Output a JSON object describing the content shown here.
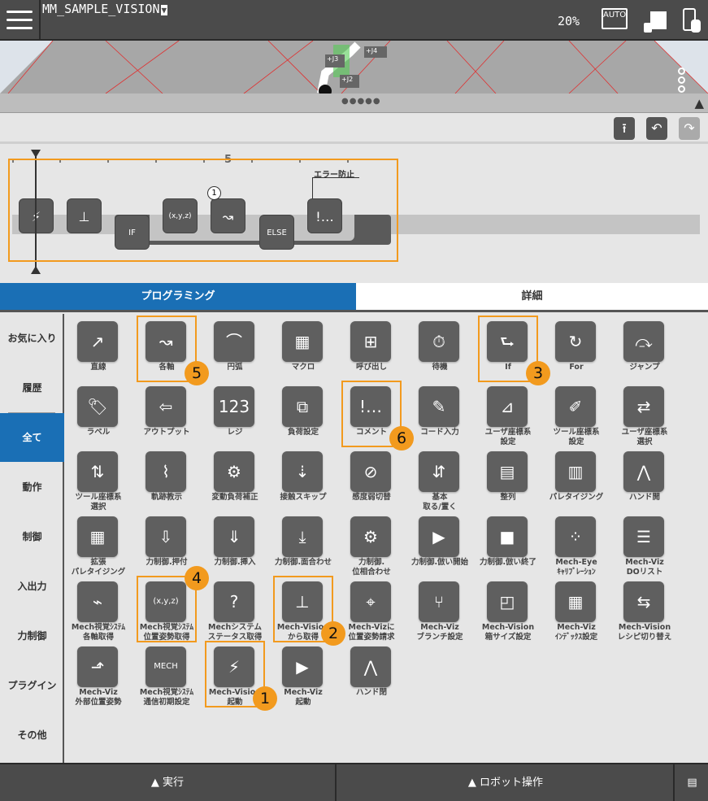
{
  "header": {
    "program_name": "MM_SAMPLE_VISION",
    "dropdown_glyph": "▼",
    "speed": "20%",
    "auto_label": "AUTO",
    "joint_labels": [
      "+J4",
      "+J3",
      "+J2"
    ]
  },
  "toolbar": {
    "upload_glyph": "⭱",
    "undo_glyph": "↶",
    "redo_glyph": "↷"
  },
  "timeline": {
    "ruler_label": "5",
    "comment_label": "エラー防止",
    "marker": "1",
    "blocks": [
      {
        "name": "mech-vision-start-block",
        "glyph": "⚡"
      },
      {
        "name": "mech-vision-get-block",
        "glyph": "⊥"
      },
      {
        "name": "if-block",
        "glyph": "IF"
      },
      {
        "name": "position-get-block",
        "glyph": "(x,y,z)"
      },
      {
        "name": "joint-move-block",
        "glyph": "↝"
      },
      {
        "name": "else-block",
        "glyph": "ELSE"
      },
      {
        "name": "comment-block",
        "glyph": "!…"
      }
    ]
  },
  "tabs": {
    "programming": "プログラミング",
    "details": "詳細"
  },
  "sidebar": {
    "items": [
      "お気に入り",
      "履歴",
      "全て",
      "動作",
      "制御",
      "入出力",
      "力制御",
      "プラグイン",
      "その他"
    ],
    "selected": "全て"
  },
  "palette": [
    {
      "label": "直線",
      "glyph": "↗"
    },
    {
      "label": "各軸",
      "glyph": "↝"
    },
    {
      "label": "円弧",
      "glyph": "⌒"
    },
    {
      "label": "マクロ",
      "glyph": "▦"
    },
    {
      "label": "呼び出し",
      "glyph": "⊞"
    },
    {
      "label": "待機",
      "glyph": "⏱"
    },
    {
      "label": "If",
      "glyph": "⮑"
    },
    {
      "label": "For",
      "glyph": "↻"
    },
    {
      "label": "ジャンプ",
      "glyph": "⤼"
    },
    {
      "label": "ラベル",
      "glyph": "🏷"
    },
    {
      "label": "アウトプット",
      "glyph": "⇦"
    },
    {
      "label": "レジ",
      "glyph": "123"
    },
    {
      "label": "負荷設定",
      "glyph": "⧉"
    },
    {
      "label": "コメント",
      "glyph": "!…"
    },
    {
      "label": "コード入力",
      "glyph": "✎"
    },
    {
      "label": "ユーザ座標系\n設定",
      "glyph": "⊿"
    },
    {
      "label": "ツール座標系\n設定",
      "glyph": "✐"
    },
    {
      "label": "ユーザ座標系\n選択",
      "glyph": "⇄"
    },
    {
      "label": "ツール座標系\n選択",
      "glyph": "⇅"
    },
    {
      "label": "軌跡教示",
      "glyph": "⌇"
    },
    {
      "label": "変動負荷補正",
      "glyph": "⚙"
    },
    {
      "label": "接触スキップ",
      "glyph": "⇣"
    },
    {
      "label": "感度弱切替",
      "glyph": "⊘"
    },
    {
      "label": "基本\n取る/置く",
      "glyph": "⇵"
    },
    {
      "label": "整列",
      "glyph": "▤"
    },
    {
      "label": "パレタイジング",
      "glyph": "▥"
    },
    {
      "label": "ハンド開",
      "glyph": "⋀"
    },
    {
      "label": "拡張\nパレタイジング",
      "glyph": "▦"
    },
    {
      "label": "力制御.押付",
      "glyph": "⇩"
    },
    {
      "label": "力制御.挿入",
      "glyph": "⇓"
    },
    {
      "label": "力制御.面合わせ",
      "glyph": "⤓"
    },
    {
      "label": "力制御.\n位相合わせ",
      "glyph": "⚙"
    },
    {
      "label": "力制御.倣い開始",
      "glyph": "▶"
    },
    {
      "label": "力制御.倣い終了",
      "glyph": "■"
    },
    {
      "label": "Mech-Eye\nｷｬﾘﾌﾞﾚｰｼｮﾝ",
      "glyph": "⁘"
    },
    {
      "label": "Mech-Viz\nDOリスト",
      "glyph": "☰"
    },
    {
      "label": "Mech視覚ｼｽﾃﾑ\n各軸取得",
      "glyph": "⌁"
    },
    {
      "label": "Mech視覚ｼｽﾃﾑ\n位置姿勢取得",
      "glyph": "(x,y,z)"
    },
    {
      "label": "Mechシステム\nステータス取得",
      "glyph": "?"
    },
    {
      "label": "Mech-Vision\nから取得",
      "glyph": "⊥"
    },
    {
      "label": "Mech-Vizに\n位置姿勢請求",
      "glyph": "⌖"
    },
    {
      "label": "Mech-Viz\nブランチ設定",
      "glyph": "⑂"
    },
    {
      "label": "Mech-Vision\n箱サイズ設定",
      "glyph": "◰"
    },
    {
      "label": "Mech-Viz\nｲﾝﾃﾞｯｸｽ設定",
      "glyph": "▦"
    },
    {
      "label": "Mech-Vision\nレシピ切り替え",
      "glyph": "⇆"
    },
    {
      "label": "Mech-Viz\n外部位置姿勢",
      "glyph": "⬏"
    },
    {
      "label": "Mech視覚ｼｽﾃﾑ\n通信初期設定",
      "glyph": "MECH"
    },
    {
      "label": "Mech-Vision\n起動",
      "glyph": "⚡"
    },
    {
      "label": "Mech-Viz\n起動",
      "glyph": "▶"
    },
    {
      "label": "ハンド閉",
      "glyph": "⋀"
    }
  ],
  "highlights": [
    {
      "item": "各軸",
      "number": "5"
    },
    {
      "item": "If",
      "number": "3"
    },
    {
      "item": "コメント",
      "number": "6"
    },
    {
      "item": "Mech視覚ｼｽﾃﾑ\n位置姿勢取得",
      "number": "4"
    },
    {
      "item": "Mech-Vision\nから取得",
      "number": "2"
    },
    {
      "item": "Mech-Vision\n起動",
      "number": "1"
    }
  ],
  "bottom": {
    "run": "▲ 実行",
    "robot": "▲ ロボット操作",
    "panel_glyph": "▤"
  },
  "colors": {
    "accent": "#1a6fb5",
    "highlight": "#f29a1e",
    "dark": "#4b4b4b"
  }
}
